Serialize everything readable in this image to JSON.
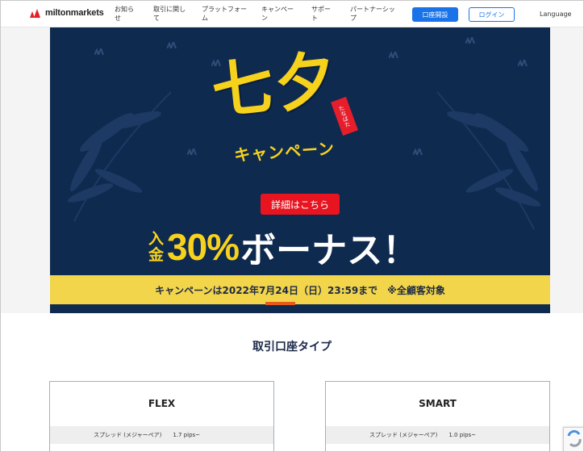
{
  "header": {
    "logo_text": "miltonmarkets",
    "nav": [
      "お知らせ",
      "取引に関して",
      "プラットフォーム",
      "キャンペーン",
      "サポート",
      "パートナーシップ"
    ],
    "open_account_label": "口座開設",
    "login_label": "ログイン",
    "language_label": "Language"
  },
  "banner": {
    "title": "七夕",
    "tag_text": "たなばた",
    "campaign_label": "キャンペーン",
    "detail_button_label": "詳細はこちら",
    "bonus_prefix_1": "入",
    "bonus_prefix_2": "金",
    "bonus_percent": "30%",
    "bonus_text": "ボーナス！",
    "deadline_text": "キャンペーンは2022年7月24日（日）23:59まで　※全顧客対象"
  },
  "accounts": {
    "section_title": "取引口座タイプ",
    "cards": [
      {
        "name": "FLEX",
        "spread_label": "スプレッド (メジャーペア)",
        "spread_value": "1.7 pips~"
      },
      {
        "name": "SMART",
        "spread_label": "スプレッド (メジャーペア)",
        "spread_value": "1.0 pips~"
      }
    ]
  },
  "colors": {
    "banner_bg": "#0f2a4f",
    "accent_yellow": "#f7d21d",
    "button_blue": "#1a73e8",
    "detail_red": "#e8141f"
  }
}
